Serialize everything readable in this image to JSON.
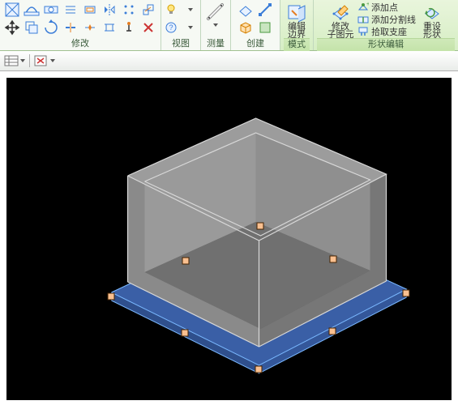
{
  "ribbon": {
    "panels": {
      "modify": {
        "label": "修改"
      },
      "view": {
        "label": "视图"
      },
      "measure": {
        "label": "测量"
      },
      "create": {
        "label": "创建"
      },
      "mode": {
        "label": "模式"
      },
      "shapeEdit": {
        "label": "形状编辑"
      }
    },
    "buttons": {
      "editBoundary": {
        "line1": "编辑",
        "line2": "边界"
      },
      "editSubElement": {
        "line1": "修改",
        "line2": "子图元"
      },
      "addPoint": "添加点",
      "addSplitLine": "添加分割线",
      "pickSupport": "拾取支座",
      "resetShape": {
        "line1": "重设",
        "line2": "形状"
      }
    }
  },
  "icons": {
    "modify": [
      "edit-type",
      "match-type",
      "cut-geom",
      "join-geom",
      "align",
      "offset",
      "mirror",
      "array",
      "pin",
      "copy",
      "rotate",
      "trim",
      "split",
      "scale",
      "paste",
      "move",
      "delete",
      "filter",
      "dim",
      "grid-align",
      "dim-types"
    ],
    "mode_ok": "finish-edit-mode",
    "mode_cancel": "cancel-edit-mode"
  },
  "colors": {
    "accent_green": "#b7d99e",
    "floor_blue": "#3a5fa6",
    "floor_blue_edge": "#7ab8ff",
    "box_fill": "#8a8a8a",
    "box_fill_dark": "#6f6f6f",
    "box_edge": "#d0d0d0",
    "grip_fill": "#fac090",
    "grip_border": "#442200"
  },
  "secondaryBar": {
    "buttons": [
      "list-view",
      "thumbnail-view",
      "close-view"
    ]
  }
}
